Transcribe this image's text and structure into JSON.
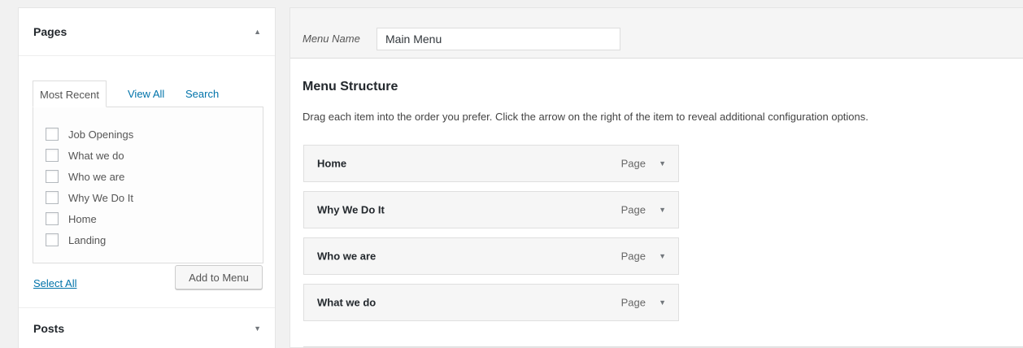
{
  "sidebar": {
    "pages": {
      "title": "Pages",
      "collapse_icon": "triangle-up",
      "tabs": [
        {
          "label": "Most Recent",
          "active": true
        },
        {
          "label": "View All",
          "active": false
        },
        {
          "label": "Search",
          "active": false
        }
      ],
      "items": [
        {
          "label": "Job Openings",
          "checked": false
        },
        {
          "label": "What we do",
          "checked": false
        },
        {
          "label": "Who we are",
          "checked": false
        },
        {
          "label": "Why We Do It",
          "checked": false
        },
        {
          "label": "Home",
          "checked": false
        },
        {
          "label": "Landing",
          "checked": false
        }
      ],
      "select_all_label": "Select All",
      "add_button_label": "Add to Menu"
    },
    "posts": {
      "title": "Posts",
      "expand_icon": "triangle-down"
    }
  },
  "main": {
    "menu_name_label": "Menu Name",
    "menu_name_value": "Main Menu",
    "structure_title": "Menu Structure",
    "instructions": "Drag each item into the order you prefer. Click the arrow on the right of the item to reveal additional configuration options.",
    "menu_items": [
      {
        "title": "Home",
        "type": "Page"
      },
      {
        "title": "Why We Do It",
        "type": "Page"
      },
      {
        "title": "Who we are",
        "type": "Page"
      },
      {
        "title": "What we do",
        "type": "Page"
      }
    ]
  },
  "colors": {
    "link": "#0073aa",
    "background": "#f1f1f1",
    "panel": "#ffffff",
    "border": "#dddddd"
  }
}
